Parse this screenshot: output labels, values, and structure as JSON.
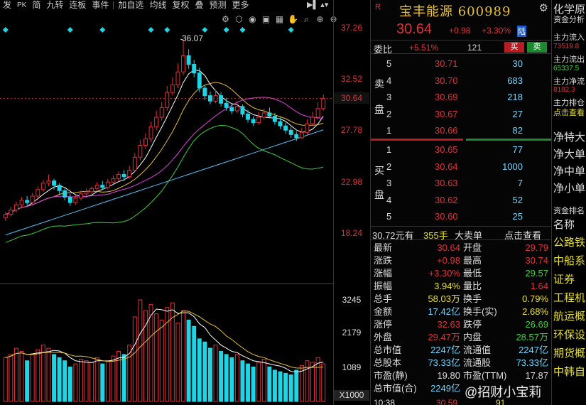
{
  "toolbar": {
    "items": [
      "发",
      "PK",
      "简",
      "九转",
      "连板",
      "事件",
      "加自选",
      "均线",
      "复权",
      "叠",
      "预测",
      "更多"
    ]
  },
  "chart": {
    "price_axis": [
      "37.26",
      "32.52",
      "30.64",
      "27.78",
      "22.98",
      "18.24"
    ],
    "high_marker": "36.07",
    "volume_axis": [
      "3245",
      "2179",
      "1089"
    ],
    "volume_unit": "X1000",
    "kline_values": {
      "open": [
        19.6,
        19.9,
        20.3,
        20.8,
        21.2,
        21.0,
        21.6,
        22.2,
        22.8,
        23.0,
        22.6,
        22.1,
        21.5,
        21.0,
        21.4,
        21.8,
        22.0,
        22.3,
        22.6,
        22.4,
        22.9,
        23.2,
        23.6,
        23.4,
        24.0,
        25.2,
        26.3,
        26.9,
        28.0,
        28.9,
        29.8,
        31.2,
        31.9,
        33.1,
        34.6,
        33.8,
        33.0,
        31.6,
        30.9,
        30.4,
        30.9,
        30.2,
        29.8,
        29.5,
        29.9,
        29.2,
        28.7,
        28.4,
        28.9,
        29.3,
        29.0,
        28.5,
        28.1,
        27.7,
        27.3,
        27.0,
        27.5,
        28.3,
        28.9,
        29.7
      ],
      "close": [
        19.9,
        20.3,
        20.8,
        21.2,
        21.0,
        21.6,
        22.2,
        22.8,
        23.0,
        22.6,
        22.1,
        21.5,
        21.0,
        21.4,
        21.8,
        22.0,
        22.3,
        22.6,
        22.4,
        22.9,
        23.2,
        23.6,
        23.4,
        24.0,
        25.2,
        26.3,
        26.9,
        28.0,
        28.9,
        29.8,
        31.2,
        31.9,
        33.1,
        34.6,
        33.8,
        33.0,
        31.6,
        30.9,
        30.4,
        30.9,
        30.2,
        29.8,
        29.5,
        29.9,
        29.2,
        28.7,
        28.4,
        28.9,
        29.3,
        29.0,
        28.5,
        28.1,
        27.7,
        27.3,
        27.0,
        27.5,
        28.3,
        28.9,
        29.7,
        30.64
      ],
      "high": [
        20.1,
        20.6,
        21.1,
        21.5,
        21.6,
        21.9,
        22.5,
        23.1,
        23.6,
        23.2,
        22.8,
        22.3,
        21.8,
        21.7,
        22.1,
        22.3,
        22.5,
        22.9,
        23.0,
        23.2,
        23.5,
        23.9,
        24.0,
        24.4,
        25.6,
        26.8,
        27.4,
        28.5,
        29.5,
        30.3,
        31.8,
        32.6,
        33.9,
        36.07,
        35.2,
        34.2,
        33.5,
        31.9,
        31.3,
        31.4,
        31.2,
        30.7,
        30.1,
        30.4,
        30.1,
        29.6,
        29.0,
        29.4,
        29.7,
        29.8,
        29.3,
        28.9,
        28.4,
        28.0,
        27.6,
        27.9,
        28.7,
        29.4,
        30.3,
        31.0
      ],
      "low": [
        19.3,
        19.7,
        20.1,
        20.5,
        20.7,
        20.8,
        21.4,
        22.0,
        22.5,
        22.2,
        21.8,
        21.2,
        20.7,
        20.8,
        21.2,
        21.6,
        21.8,
        22.1,
        22.2,
        22.2,
        22.7,
        23.0,
        23.1,
        23.2,
        23.8,
        24.9,
        26.0,
        26.6,
        27.7,
        28.6,
        29.5,
        30.9,
        31.6,
        32.8,
        33.4,
        32.6,
        31.2,
        30.5,
        30.1,
        30.2,
        29.9,
        29.5,
        29.2,
        29.3,
        28.9,
        28.4,
        28.1,
        28.2,
        28.7,
        28.8,
        28.2,
        27.8,
        27.4,
        27.0,
        26.7,
        26.9,
        27.3,
        28.1,
        28.7,
        29.5
      ]
    },
    "volume_values": [
      1400,
      1500,
      1700,
      1600,
      1300,
      1500,
      1650,
      1800,
      1700,
      1500,
      1400,
      1300,
      1100,
      1200,
      1350,
      1300,
      1250,
      1400,
      1200,
      1300,
      1450,
      1600,
      1500,
      1800,
      2700,
      3245,
      2900,
      3100,
      2800,
      2600,
      3000,
      3150,
      2500,
      2900,
      2600,
      2400,
      2000,
      1900,
      1700,
      1800,
      1600,
      1500,
      1400,
      1500,
      1300,
      1200,
      1100,
      1250,
      1350,
      1100,
      1000,
      950,
      900,
      850,
      1000,
      1150,
      1300,
      1250,
      1400,
      1200
    ]
  },
  "quote": {
    "r_mark": "R",
    "stock_name": "宝丰能源",
    "stock_code": "600989",
    "last_price": "30.64",
    "change": "+0.98",
    "change_pct": "+3.30%",
    "market_badge": "陆",
    "webi_label": "委比",
    "webi_value": "+5.51%",
    "webi_diff": "121",
    "buy_label": "买",
    "sell_label": "卖",
    "ask_side_label": [
      "卖",
      "盘"
    ],
    "bid_side_label": [
      "买",
      "盘"
    ],
    "asks": [
      {
        "level": "5",
        "price": "30.71",
        "volume": "30"
      },
      {
        "level": "4",
        "price": "30.70",
        "volume": "683"
      },
      {
        "level": "3",
        "price": "30.69",
        "volume": "218"
      },
      {
        "level": "2",
        "price": "30.67",
        "volume": "27"
      },
      {
        "level": "1",
        "price": "30.66",
        "volume": "82"
      }
    ],
    "bids": [
      {
        "level": "1",
        "price": "30.65",
        "volume": "77"
      },
      {
        "level": "2",
        "price": "30.64",
        "volume": "1000"
      },
      {
        "level": "3",
        "price": "30.63",
        "volume": "7"
      },
      {
        "level": "4",
        "price": "30.62",
        "volume": "52"
      },
      {
        "level": "5",
        "price": "30.60",
        "volume": "25"
      }
    ],
    "avg_price": "30.72元有",
    "avg_vol": "355手",
    "big_order": "大卖单",
    "view_link": "点击查看",
    "stats": [
      {
        "k": "最新",
        "v": "30.64",
        "color": "#e0303a"
      },
      {
        "k": "开盘",
        "v": "29.79",
        "color": "#e0303a"
      },
      {
        "k": "涨跌",
        "v": "+0.98",
        "color": "#e0303a"
      },
      {
        "k": "最高",
        "v": "30.74",
        "color": "#e0303a"
      },
      {
        "k": "涨幅",
        "v": "+3.30%",
        "color": "#e0303a"
      },
      {
        "k": "最低",
        "v": "29.57",
        "color": "#3ad13a"
      },
      {
        "k": "振幅",
        "v": "3.94%",
        "color": "#e8e030"
      },
      {
        "k": "量比",
        "v": "1.64",
        "color": "#e0303a"
      },
      {
        "k": "总手",
        "v": "58.03万",
        "color": "#e8e030"
      },
      {
        "k": "换手",
        "v": "0.79%",
        "color": "#e8e030"
      },
      {
        "k": "金额",
        "v": "17.42亿",
        "color": "#6fd6ff"
      },
      {
        "k": "换手(实)",
        "v": "2.68%",
        "color": "#e8e030"
      },
      {
        "k": "涨停",
        "v": "32.63",
        "color": "#e0303a"
      },
      {
        "k": "跌停",
        "v": "26.69",
        "color": "#3ad13a"
      },
      {
        "k": "外盘",
        "v": "29.47万",
        "color": "#e0303a"
      },
      {
        "k": "内盘",
        "v": "28.57万",
        "color": "#3ad13a"
      },
      {
        "k": "总市值",
        "v": "2247亿",
        "color": "#6fd6ff"
      },
      {
        "k": "流通值",
        "v": "2247亿",
        "color": "#6fd6ff"
      },
      {
        "k": "总股本",
        "v": "73.33亿",
        "color": "#6fd6ff"
      },
      {
        "k": "流通股",
        "v": "73.33亿",
        "color": "#6fd6ff"
      },
      {
        "k": "市盈(静)",
        "v": "19.80",
        "color": "#ddd"
      },
      {
        "k": "市盈(TTM)",
        "v": "17.87",
        "color": "#ddd"
      },
      {
        "k": "总市值(合)",
        "v": "2249亿",
        "color": "#6fd6ff"
      }
    ],
    "bottom_time": "10:38",
    "bottom_price": "30.59",
    "bottom_vol": "91"
  },
  "side": {
    "items": [
      {
        "t": "化学原",
        "c": "#ddd"
      },
      {
        "t": "资金分析",
        "c": "#ddd"
      },
      {
        "t": "主力流入",
        "c": "#ddd"
      },
      {
        "t": "73519.8",
        "c": "#e0303a"
      },
      {
        "t": "主力流出",
        "c": "#ddd"
      },
      {
        "t": "65337.5",
        "c": "#3ad13a"
      },
      {
        "t": "主力净流",
        "c": "#ddd"
      },
      {
        "t": "8182.3",
        "c": "#e0303a"
      },
      {
        "t": "主力排仓",
        "c": "#ddd"
      },
      {
        "t": "点击查看",
        "c": "#e8e030"
      },
      {
        "t": "净特大",
        "c": "#ddd"
      },
      {
        "t": "净大单",
        "c": "#ddd"
      },
      {
        "t": "净中单",
        "c": "#ddd"
      },
      {
        "t": "净小单",
        "c": "#ddd"
      },
      {
        "t": "资金排名",
        "c": "#ddd"
      },
      {
        "t": "名称",
        "c": "#ddd"
      },
      {
        "t": "公路铁",
        "c": "#e8e030"
      },
      {
        "t": "中船系",
        "c": "#e8e030"
      },
      {
        "t": "证券",
        "c": "#e8e030"
      },
      {
        "t": "工程机",
        "c": "#e8e030"
      },
      {
        "t": "航运概",
        "c": "#e8e030"
      },
      {
        "t": "环保设",
        "c": "#e8e030"
      },
      {
        "t": "期货概",
        "c": "#e8e030"
      },
      {
        "t": "中韩自",
        "c": "#e8e030"
      }
    ]
  },
  "watermark": "@招财小宝莉",
  "colors": {
    "up": "#e0303a",
    "down": "#1fd5e5",
    "ma5": "#ffffff",
    "ma10": "#e8c030",
    "ma20": "#e040e0",
    "ma60": "#3ad13a",
    "ma120": "#4fc3f7"
  }
}
